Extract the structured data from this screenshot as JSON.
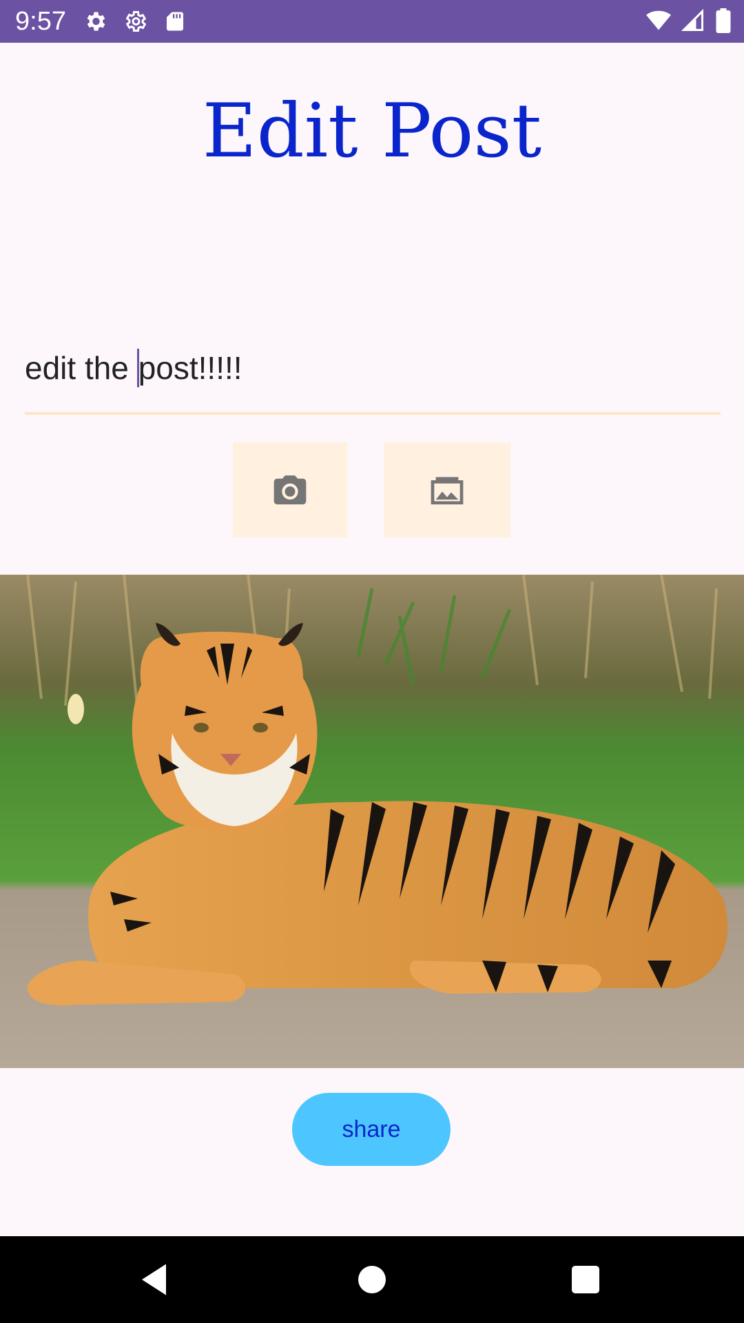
{
  "status_bar": {
    "time": "9:57",
    "left_icons": [
      "settings-icon",
      "settings-outline-icon",
      "sd-card-icon"
    ],
    "right_icons": [
      "wifi-icon",
      "signal-icon",
      "battery-icon"
    ],
    "background": "#6b52a3"
  },
  "page": {
    "title": "Edit Post",
    "title_color": "#0a25cc"
  },
  "post_text_field": {
    "value_before_caret": "edit the ",
    "value_after_caret": "post!!!!!"
  },
  "media_buttons": {
    "camera_icon": "camera-icon",
    "gallery_icon": "image-gallery-icon",
    "background": "#fff0e0"
  },
  "post_image": {
    "subject": "tiger"
  },
  "share_button": {
    "label": "share",
    "background": "#4dc6ff"
  },
  "nav_bar": {
    "icons": [
      "back-icon",
      "home-icon",
      "recents-icon"
    ]
  }
}
